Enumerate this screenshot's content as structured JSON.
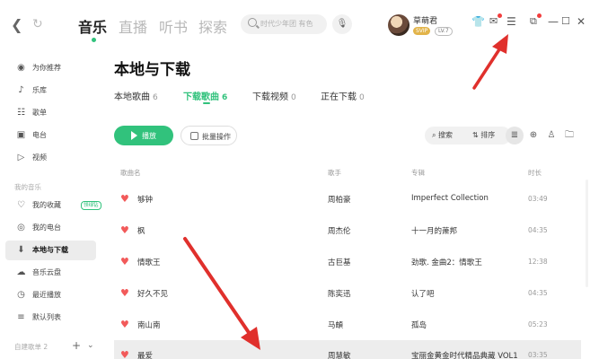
{
  "topbar": {
    "back_icon": "chevron-left-icon",
    "refresh_icon": "refresh-icon",
    "tabs": [
      {
        "label": "音乐",
        "active": true
      },
      {
        "label": "直播",
        "active": false
      },
      {
        "label": "听书",
        "active": false
      },
      {
        "label": "探索",
        "active": false
      }
    ],
    "search_placeholder": "时代少年团 有色",
    "user": {
      "name": "草萌君",
      "vip": "SVIP",
      "level": "LV.7"
    },
    "icons": [
      "tshirt-icon",
      "mail-icon",
      "menu-icon",
      "miniplayer-icon",
      "minimize-icon",
      "maximize-icon",
      "close-icon"
    ]
  },
  "sidebar": {
    "items": [
      {
        "label": "为你推荐",
        "icon": "recommend-icon"
      },
      {
        "label": "乐库",
        "icon": "library-icon"
      },
      {
        "label": "歌单",
        "icon": "playlist-icon"
      },
      {
        "label": "电台",
        "icon": "radio-icon"
      },
      {
        "label": "视频",
        "icon": "video-icon"
      }
    ],
    "section_my": "我的音乐",
    "my_items": [
      {
        "label": "我的收藏",
        "icon": "heart-icon",
        "badge": "领绿钻"
      },
      {
        "label": "我的电台",
        "icon": "radio-icon"
      },
      {
        "label": "本地与下载",
        "icon": "download-icon",
        "active": true
      },
      {
        "label": "音乐云盘",
        "icon": "cloud-icon"
      },
      {
        "label": "最近播放",
        "icon": "clock-icon"
      },
      {
        "label": "默认列表",
        "icon": "list-icon"
      }
    ],
    "section_custom": "自建歌单 2"
  },
  "main": {
    "title": "本地与下载",
    "subtabs": [
      {
        "label": "本地歌曲",
        "count": "6",
        "active": false
      },
      {
        "label": "下载歌曲",
        "count": "6",
        "active": true
      },
      {
        "label": "下载视频",
        "count": "0",
        "active": false
      },
      {
        "label": "正在下载",
        "count": "0",
        "active": false
      }
    ],
    "play_label": "播放",
    "batch_label": "批量操作",
    "search_label": "搜索",
    "sort_label": "排序",
    "columns": {
      "song": "歌曲名",
      "artist": "歌手",
      "album": "专辑",
      "time": "时长"
    },
    "rows": [
      {
        "song": "够钟",
        "artist": "周柏豪",
        "album": "Imperfect Collection",
        "time": "03:49"
      },
      {
        "song": "枫",
        "artist": "周杰伦",
        "album": "十一月的萧邦",
        "time": "04:35"
      },
      {
        "song": "情歌王",
        "artist": "古巨基",
        "album": "劲歌. 金曲2：情歌王",
        "time": "12:38"
      },
      {
        "song": "好久不见",
        "artist": "陈奕迅",
        "album": "认了吧",
        "time": "04:35"
      },
      {
        "song": "南山南",
        "artist": "马頔",
        "album": "孤岛",
        "time": "05:23"
      },
      {
        "song": "最爱",
        "artist": "周慧敏",
        "album": "宝丽金黄金时代精品典藏 VOL1",
        "time": "03:35"
      }
    ]
  },
  "colors": {
    "accent": "#31c27c",
    "annotation": "#e0302c",
    "heart": "#f25a5a"
  }
}
